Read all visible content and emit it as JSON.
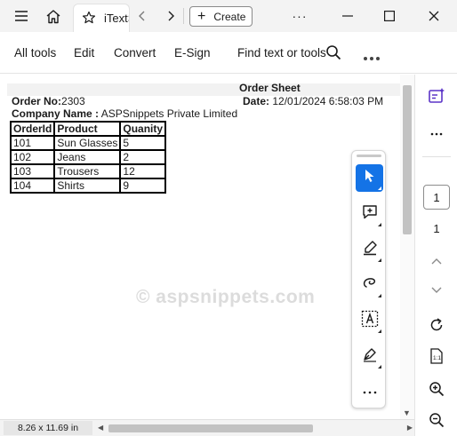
{
  "browser": {
    "tab_title": "iTextSharp",
    "create_label": "Create",
    "more_label": "···"
  },
  "toolbar": {
    "all_tools": "All tools",
    "edit": "Edit",
    "convert": "Convert",
    "esign": "E-Sign",
    "find": "Find text or tools"
  },
  "document": {
    "title": "Order Sheet",
    "order_no_label": "Order No:",
    "order_no": "2303",
    "date_label": "Date:",
    "date": "12/01/2024 6:58:03 PM",
    "company_label": "Company Name :",
    "company": "ASPSnippets Private Limited",
    "table": {
      "headers": [
        "OrderId",
        "Product",
        "Quanity"
      ],
      "rows": [
        [
          "101",
          "Sun Glasses",
          "5"
        ],
        [
          "102",
          "Jeans",
          "2"
        ],
        [
          "103",
          "Trousers",
          "12"
        ],
        [
          "104",
          "Shirts",
          "9"
        ]
      ]
    },
    "watermark": "© aspsnippets.com"
  },
  "sidebar": {
    "current_page": "1",
    "total_pages": "1"
  },
  "status": {
    "page_size": "8.26 x 11.69 in"
  },
  "colors": {
    "accent": "#1473e6",
    "rail_accent": "#5b34c7"
  }
}
